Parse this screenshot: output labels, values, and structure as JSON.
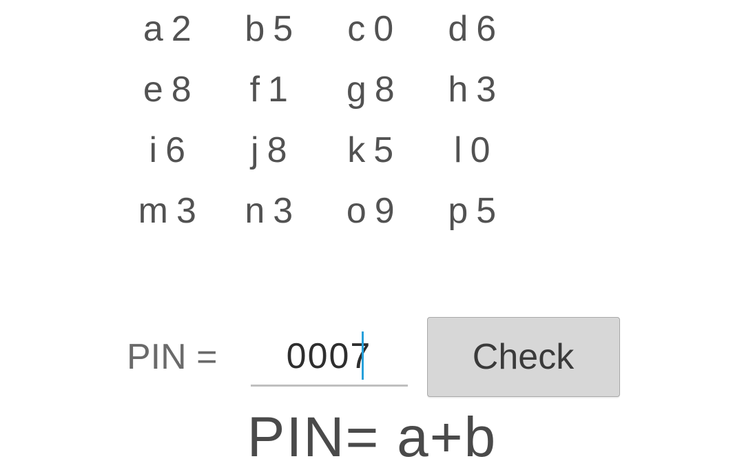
{
  "grid": {
    "rows": [
      [
        {
          "letter": "a",
          "value": "2"
        },
        {
          "letter": "b",
          "value": "5"
        },
        {
          "letter": "c",
          "value": "0"
        },
        {
          "letter": "d",
          "value": "6"
        }
      ],
      [
        {
          "letter": "e",
          "value": "8"
        },
        {
          "letter": "f",
          "value": "1"
        },
        {
          "letter": "g",
          "value": "8"
        },
        {
          "letter": "h",
          "value": "3"
        }
      ],
      [
        {
          "letter": "i",
          "value": "6"
        },
        {
          "letter": "j",
          "value": "8"
        },
        {
          "letter": "k",
          "value": "5"
        },
        {
          "letter": "l",
          "value": "0"
        }
      ],
      [
        {
          "letter": "m",
          "value": "3"
        },
        {
          "letter": "n",
          "value": "3"
        },
        {
          "letter": "o",
          "value": "9"
        },
        {
          "letter": "p",
          "value": "5"
        }
      ]
    ]
  },
  "pin": {
    "label": "PIN =",
    "value": "0007"
  },
  "check_button_label": "Check",
  "formula_text": "PIN= a+b"
}
